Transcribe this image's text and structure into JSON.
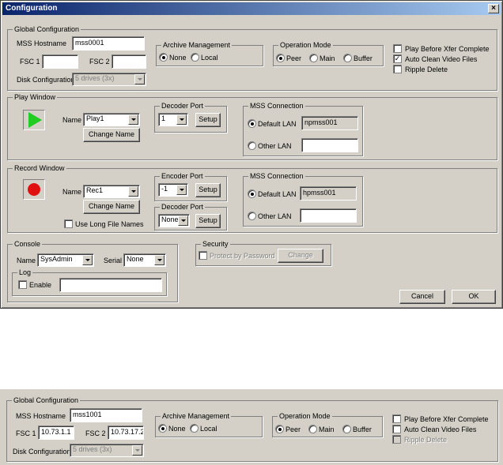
{
  "window": {
    "title": "Configuration",
    "close_glyph": "×"
  },
  "global": {
    "legend": "Global Configuration",
    "mss_hostname_label": "MSS Hostname",
    "mss_hostname_value": "mss0001",
    "fsc1_label": "FSC 1",
    "fsc1_value": "",
    "fsc2_label": "FSC 2",
    "fsc2_value": "",
    "disk_config_label": "Disk Configuration",
    "disk_config_value": "5 drives (3x)"
  },
  "archive": {
    "legend": "Archive Management",
    "none_label": "None",
    "local_label": "Local",
    "selected": "None"
  },
  "operation": {
    "legend": "Operation Mode",
    "peer_label": "Peer",
    "main_label": "Main",
    "buffer_label": "Buffer",
    "selected": "Peer"
  },
  "options": {
    "play_before_xfer_label": "Play Before Xfer Complete",
    "play_before_xfer_checked": false,
    "auto_clean_label": "Auto Clean Video Files",
    "auto_clean_checked": true,
    "ripple_delete_label": "Ripple Delete",
    "ripple_delete_checked": false
  },
  "play_window": {
    "legend": "Play Window",
    "name_label": "Name",
    "name_value": "Play1",
    "change_name_label": "Change Name",
    "decoder_port_legend": "Decoder Port",
    "decoder_port_value": "1",
    "setup_label": "Setup",
    "mss_legend": "MSS Connection",
    "default_lan_label": "Default LAN",
    "default_lan_value": "npmss001",
    "other_lan_label": "Other LAN",
    "other_lan_value": "",
    "selected": "Default LAN"
  },
  "record_window": {
    "legend": "Record Window",
    "name_label": "Name",
    "name_value": "Rec1",
    "change_name_label": "Change Name",
    "long_names_label": "Use Long File Names",
    "long_names_checked": false,
    "encoder_port_legend": "Encoder Port",
    "encoder_port_value": "-1",
    "decoder_port_legend": "Decoder Port",
    "decoder_port_value": "None",
    "setup_label": "Setup",
    "mss_legend": "MSS Connection",
    "default_lan_label": "Default LAN",
    "default_lan_value": "hpmss001",
    "other_lan_label": "Other LAN",
    "other_lan_value": "",
    "selected": "Default LAN"
  },
  "console": {
    "legend": "Console",
    "name_label": "Name",
    "name_value": "SysAdmin",
    "serial_label": "Serial",
    "serial_value": "None",
    "log_legend": "Log",
    "enable_label": "Enable",
    "enable_checked": false,
    "log_path_value": ""
  },
  "security": {
    "legend": "Security",
    "protect_label": "Protect by Password",
    "protect_checked": false,
    "change_label": "Change"
  },
  "footer": {
    "cancel_label": "Cancel",
    "ok_label": "OK"
  },
  "bottom_crop": {
    "legend": "Global Configuration",
    "mss_hostname_label": "MSS Hostname",
    "mss_hostname_value": "mss1001",
    "fsc1_label": "FSC 1",
    "fsc1_value": "10.73.1.1",
    "fsc2_label": "FSC 2",
    "fsc2_value": "10.73.17.2",
    "disk_config_label": "Disk Configuration",
    "disk_config_value": "5 drives (3x)",
    "archive_legend": "Archive Management",
    "none_label": "None",
    "local_label": "Local",
    "operation_legend": "Operation Mode",
    "peer_label": "Peer",
    "main_label": "Main",
    "buffer_label": "Buffer",
    "play_before_xfer_label": "Play Before Xfer Complete",
    "auto_clean_label": "Auto Clean Video Files",
    "ripple_delete_label": "Ripple Delete"
  },
  "colors": {
    "dialog_bg": "#d4d0c8",
    "title_start": "#0a246a",
    "title_end": "#a6caf0",
    "play_icon": "#22cc22",
    "record_icon": "#e01010"
  }
}
